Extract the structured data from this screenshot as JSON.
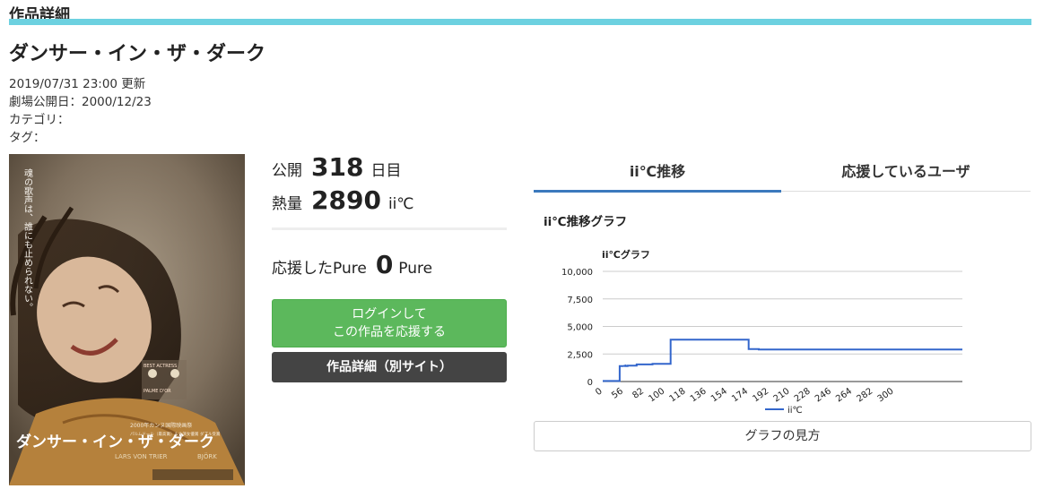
{
  "header": {
    "section_title": "作品詳細"
  },
  "work": {
    "title": "ダンサー・イン・ザ・ダーク",
    "updated": "2019/07/31 23:00 更新",
    "release": "劇場公開日：2000/12/23",
    "category": "カテゴリ：",
    "tags": "タグ："
  },
  "poster": {
    "tagline": "魂の歌声は、誰にも止められない。",
    "title_text": "ダンサー・イン・ザ・ダーク",
    "award_text": "2000年カンヌ国際映画祭",
    "award_sub": "パルムドール（最高賞）＆主演女優賞 ダブル受賞",
    "director": "LARS VON TRIER",
    "star": "BJÖRK"
  },
  "stats": {
    "days_label": "公開",
    "days_value": "318",
    "days_unit": "日目",
    "heat_label": "熱量",
    "heat_value": "2890",
    "heat_unit": "ii℃",
    "support_label": "応援したPure",
    "support_value": "0",
    "support_unit": "Pure"
  },
  "buttons": {
    "login_line1": "ログインして",
    "login_line2": "この作品を応援する",
    "detail": "作品詳細（別サイト）",
    "howto": "グラフの見方"
  },
  "tabs": {
    "active": "ii℃推移",
    "other": "応援しているユーザ"
  },
  "graph": {
    "heading": "ii℃推移グラフ"
  },
  "colors": {
    "accent_bar": "#6dd1e0",
    "green": "#5cb85c",
    "dark": "#444444",
    "line": "#3366cc"
  },
  "chart_data": {
    "type": "line",
    "title": "ii℃グラフ",
    "xlabel": "",
    "ylabel": "",
    "ylim": [
      0,
      10000
    ],
    "yticks": [
      "0",
      "2,500",
      "5,000",
      "7,500",
      "10,000"
    ],
    "xticks": [
      "0",
      "56",
      "82",
      "100",
      "118",
      "136",
      "154",
      "174",
      "192",
      "210",
      "228",
      "246",
      "264",
      "282",
      "300"
    ],
    "legend_position": "bottom",
    "series": [
      {
        "name": "ii℃",
        "x": [
          0,
          15,
          15,
          18,
          20,
          20,
          22,
          22,
          30,
          30,
          44,
          44,
          60,
          60,
          129,
          129,
          138,
          138,
          318
        ],
        "values": [
          50,
          50,
          1400,
          1400,
          1450,
          1400,
          1400,
          1450,
          1450,
          1550,
          1550,
          1600,
          1600,
          3800,
          3800,
          2950,
          2950,
          2900,
          2900
        ]
      }
    ]
  }
}
